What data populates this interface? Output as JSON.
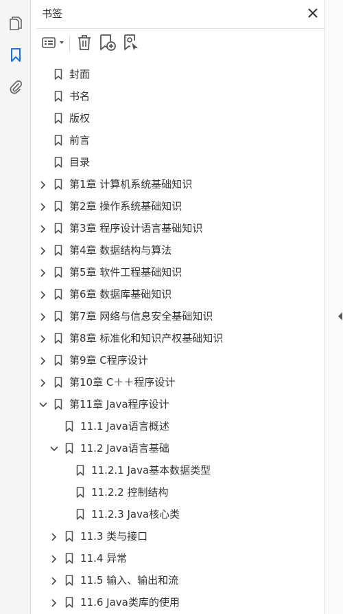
{
  "rail": {
    "items": [
      {
        "name": "page-thumbnails",
        "icon": "copy-pages-icon",
        "active": false
      },
      {
        "name": "bookmarks",
        "icon": "bookmark-icon",
        "active": true
      },
      {
        "name": "attachments",
        "icon": "paperclip-icon",
        "active": false
      }
    ],
    "accent_color": "#1473e6"
  },
  "panel": {
    "title": "书签",
    "close_icon": "close-icon",
    "toolbar": {
      "options_icon": "bookmark-options-icon",
      "delete_icon": "trash-icon",
      "new_bookmark_icon": "new-bookmark-icon",
      "find_bookmark_icon": "find-bookmark-icon"
    }
  },
  "bookmarks": [
    {
      "label": "封面",
      "level": 0,
      "expander": "none"
    },
    {
      "label": "书名",
      "level": 0,
      "expander": "none"
    },
    {
      "label": "版权",
      "level": 0,
      "expander": "none"
    },
    {
      "label": "前言",
      "level": 0,
      "expander": "none"
    },
    {
      "label": "目录",
      "level": 0,
      "expander": "none"
    },
    {
      "label": "第1章  计算机系统基础知识",
      "level": 0,
      "expander": "collapsed"
    },
    {
      "label": "第2章  操作系统基础知识",
      "level": 0,
      "expander": "collapsed"
    },
    {
      "label": "第3章  程序设计语言基础知识",
      "level": 0,
      "expander": "collapsed"
    },
    {
      "label": "第4章  数据结构与算法",
      "level": 0,
      "expander": "collapsed"
    },
    {
      "label": "第5章  软件工程基础知识",
      "level": 0,
      "expander": "collapsed"
    },
    {
      "label": "第6章  数据库基础知识",
      "level": 0,
      "expander": "collapsed"
    },
    {
      "label": "第7章  网络与信息安全基础知识",
      "level": 0,
      "expander": "collapsed"
    },
    {
      "label": "第8章  标准化和知识产权基础知识",
      "level": 0,
      "expander": "collapsed"
    },
    {
      "label": "第9章  C程序设计",
      "level": 0,
      "expander": "collapsed"
    },
    {
      "label": "第10章  C＋＋程序设计",
      "level": 0,
      "expander": "collapsed"
    },
    {
      "label": "第11章  Java程序设计",
      "level": 0,
      "expander": "expanded"
    },
    {
      "label": "11.1  Java语言概述",
      "level": 1,
      "expander": "none"
    },
    {
      "label": "11.2  Java语言基础",
      "level": 1,
      "expander": "expanded"
    },
    {
      "label": "11.2.1  Java基本数据类型",
      "level": 2,
      "expander": "none"
    },
    {
      "label": "11.2.2  控制结构",
      "level": 2,
      "expander": "none"
    },
    {
      "label": "11.2.3  Java核心类",
      "level": 2,
      "expander": "none"
    },
    {
      "label": "11.3  类与接口",
      "level": 1,
      "expander": "collapsed"
    },
    {
      "label": "11.4  异常",
      "level": 1,
      "expander": "collapsed"
    },
    {
      "label": "11.5  输入、输出和流",
      "level": 1,
      "expander": "collapsed"
    },
    {
      "label": "11.6  Java类库的使用",
      "level": 1,
      "expander": "collapsed"
    }
  ],
  "right_edge": {
    "collapse_icon": "collapse-panel-arrow-icon"
  }
}
